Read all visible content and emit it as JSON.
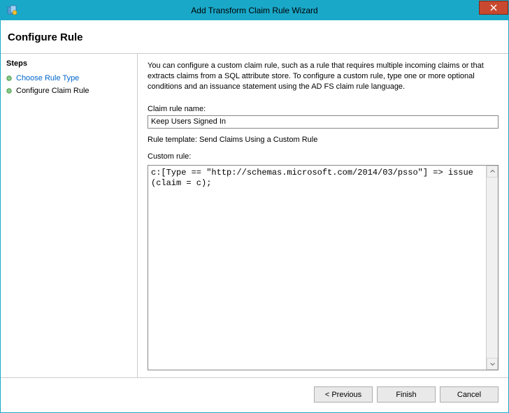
{
  "window": {
    "title": "Add Transform Claim Rule Wizard"
  },
  "header": {
    "title": "Configure Rule"
  },
  "sidebar": {
    "heading": "Steps",
    "items": [
      {
        "label": "Choose Rule Type",
        "link": true
      },
      {
        "label": "Configure Claim Rule",
        "link": false
      }
    ]
  },
  "main": {
    "intro": "You can configure a custom claim rule, such as a rule that requires multiple incoming claims or that extracts claims from a SQL attribute store. To configure a custom rule, type one or more optional conditions and an issuance statement using the AD FS claim rule language.",
    "claim_rule_name_label": "Claim rule name:",
    "claim_rule_name_value": "Keep Users Signed In",
    "rule_template_text": "Rule template: Send Claims Using a Custom Rule",
    "custom_rule_label": "Custom rule:",
    "custom_rule_value": "c:[Type == \"http://schemas.microsoft.com/2014/03/psso\"] => issue(claim = c);"
  },
  "footer": {
    "previous": "< Previous",
    "finish": "Finish",
    "cancel": "Cancel"
  }
}
